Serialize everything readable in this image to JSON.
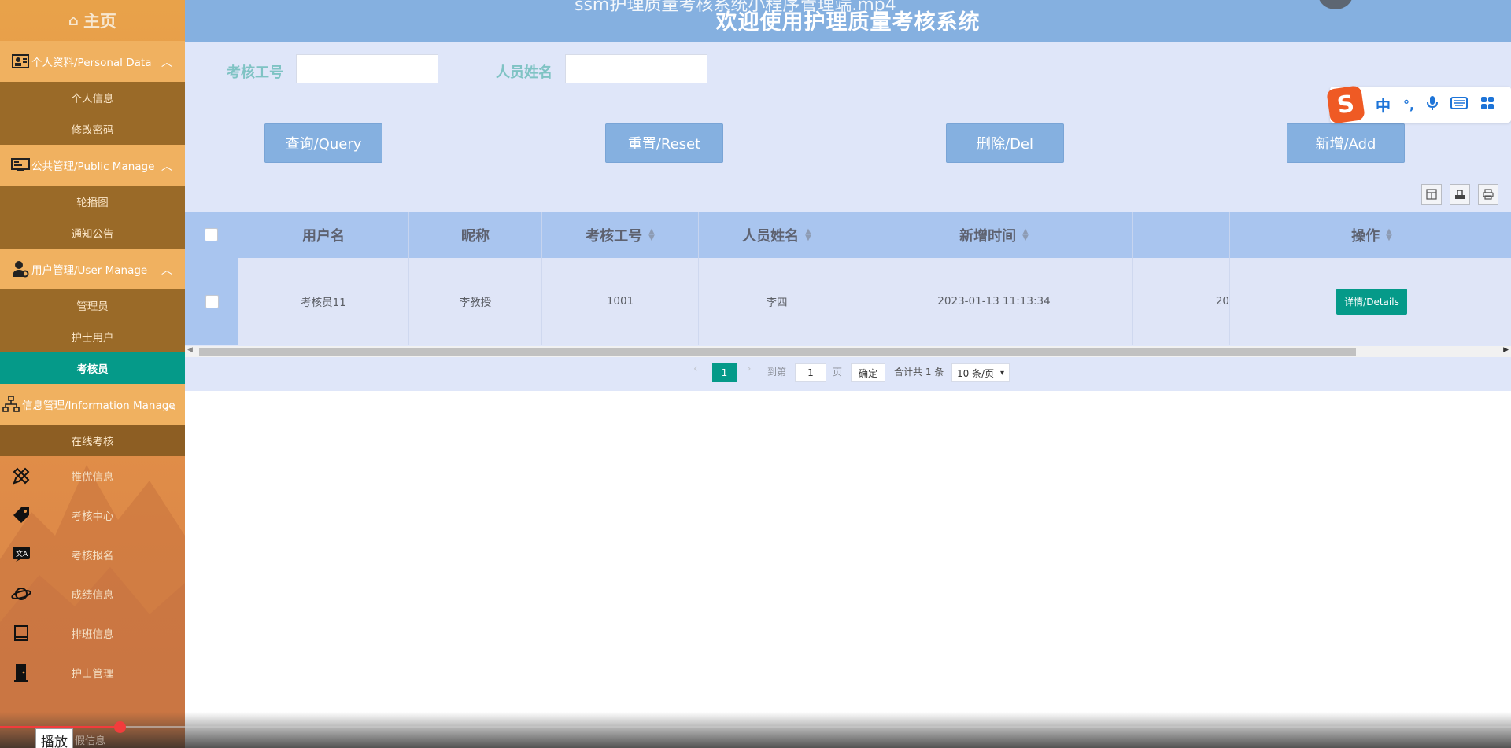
{
  "header": {
    "title": "欢迎使用护理质量考核系统",
    "ghost_text": "ssm护理质量考核系统小程序管理端.mp4"
  },
  "sidebar": {
    "home": "主页",
    "groups": [
      {
        "label": "个人资料/Personal Data",
        "items": [
          "个人信息",
          "修改密码"
        ]
      },
      {
        "label": "公共管理/Public Manage",
        "items": [
          "轮播图",
          "通知公告"
        ]
      },
      {
        "label": "用户管理/User Manage",
        "items": [
          "管理员",
          "护士用户",
          "考核员"
        ],
        "active": "考核员"
      },
      {
        "label": "信息管理/Information Manage",
        "items": [
          "在线考核"
        ]
      }
    ],
    "menu": [
      "推优信息",
      "考核中心",
      "考核报名",
      "成绩信息",
      "排班信息",
      "护士管理"
    ],
    "menu_icons": [
      "pencil-ruler-icon",
      "tag-icon",
      "translate-icon",
      "planet-icon",
      "book-icon",
      "door-icon"
    ]
  },
  "search": {
    "label_id": "考核工号",
    "value_id": "",
    "label_name": "人员姓名",
    "value_name": ""
  },
  "buttons": {
    "query": "查询/Query",
    "reset": "重置/Reset",
    "del": "删除/Del",
    "add": "新增/Add"
  },
  "table": {
    "columns": [
      "用户名",
      "昵称",
      "考核工号",
      "人员姓名",
      "新增时间",
      "",
      "操作"
    ],
    "rows": [
      {
        "username": "考核员11",
        "nickname": "李教授",
        "emp_id": "1001",
        "name": "李四",
        "created": "2023-01-13 11:13:34",
        "extra": "20",
        "action": "详情/Details"
      }
    ]
  },
  "pagination": {
    "current": "1",
    "goto_label": "到第",
    "goto_value": "1",
    "page_unit": "页",
    "confirm": "确定",
    "total": "合计共 1 条",
    "page_size": "10 条/页"
  },
  "ime": {
    "logo": "S",
    "items": [
      "中",
      "°,",
      "mic-icon",
      "keyboard-icon",
      "grid-icon"
    ],
    "lang": "中",
    "punct": "°,"
  },
  "video": {
    "play_tip": "播放",
    "ghost": "假信息"
  }
}
